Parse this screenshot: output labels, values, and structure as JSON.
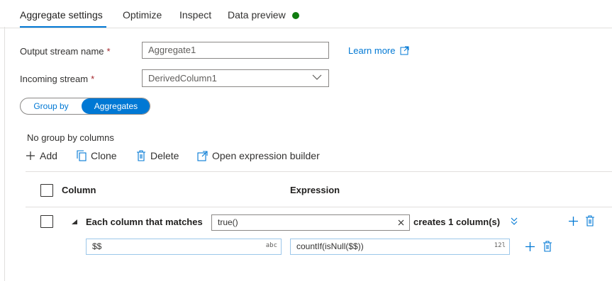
{
  "tabs": [
    {
      "label": "Aggregate settings",
      "active": true
    },
    {
      "label": "Optimize",
      "active": false
    },
    {
      "label": "Inspect",
      "active": false
    },
    {
      "label": "Data preview",
      "active": false
    }
  ],
  "status_color": "#107c10",
  "form": {
    "output_stream_label": "Output stream name",
    "output_stream_value": "Aggregate1",
    "incoming_stream_label": "Incoming stream",
    "incoming_stream_value": "DerivedColumn1",
    "required_mark": "*",
    "learn_more": "Learn more"
  },
  "toggle": {
    "left": "Group by",
    "right": "Aggregates",
    "selected": "Aggregates"
  },
  "no_group_text": "No group by columns",
  "toolbar": {
    "add": "Add",
    "clone": "Clone",
    "delete": "Delete",
    "open_builder": "Open expression builder"
  },
  "table": {
    "col_column": "Column",
    "col_expression": "Expression",
    "pattern_row": {
      "prefix": "Each column that matches",
      "match_expression": "true()",
      "suffix": "creates 1 column(s)"
    },
    "sub_row": {
      "column_name": "$$",
      "column_badge": "abc",
      "expression": "countIf(isNull($$))",
      "expression_badge": "12l"
    }
  },
  "accent_color": "#0078d4"
}
